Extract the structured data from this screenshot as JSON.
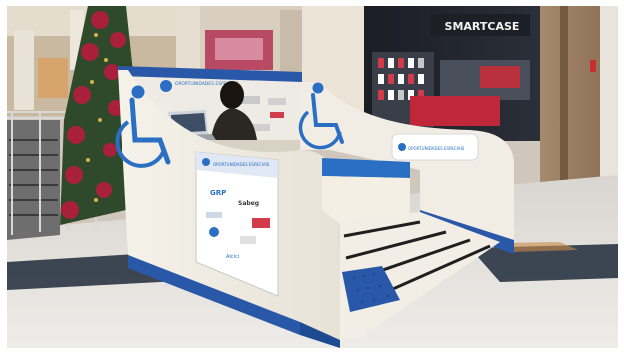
{
  "scene": {
    "store_sign": "SMARTCASE",
    "kiosk_brand": "OPORTUNIDADES ESPECIAIS",
    "panel_title": "OPORTUNIDADES ESPECIAIS",
    "bench_label": "OPORTUNIDADES ESPECIAIS",
    "sponsors": [
      "GRP",
      "Sabeg",
      "Alcici",
      "Logo",
      "Logo"
    ],
    "icon_wheelchair": "wheelchair-icon"
  }
}
